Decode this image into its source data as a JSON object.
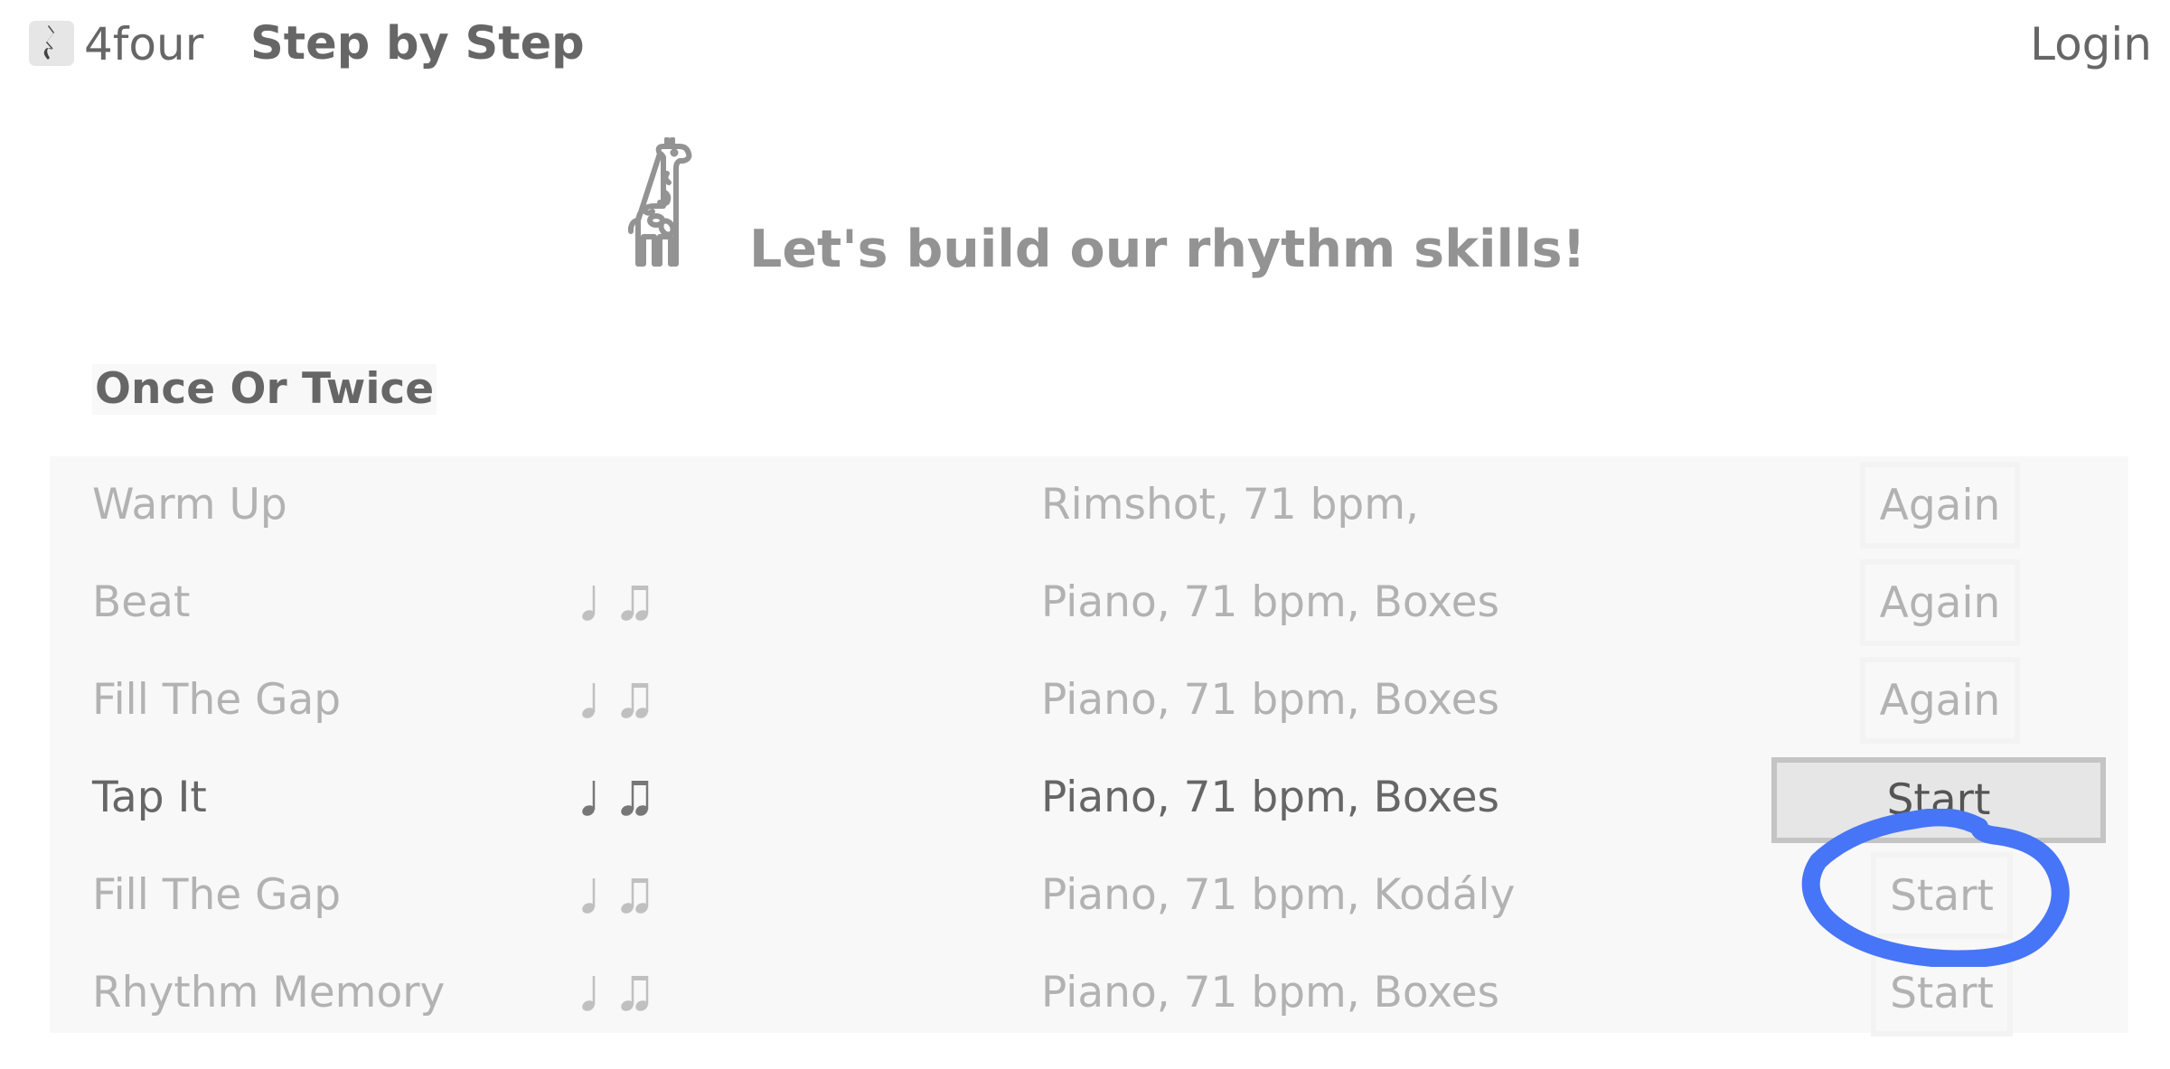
{
  "header": {
    "logo_icon": "quarter-rest-icon",
    "brand": "4four",
    "title": "Step by Step",
    "login_label": "Login"
  },
  "hero": {
    "icon": "giraffe-icon",
    "headline": "Let's build our rhythm skills!"
  },
  "section": {
    "title": "Once Or Twice"
  },
  "exercises": [
    {
      "name": "Warm Up",
      "notes": [],
      "info": "Rimshot, 71 bpm,",
      "action": "Again",
      "state": "done"
    },
    {
      "name": "Beat",
      "notes": [
        "quarter-note-icon",
        "beamed-eighth-notes-icon"
      ],
      "info": "Piano, 71 bpm, Boxes",
      "action": "Again",
      "state": "done"
    },
    {
      "name": "Fill The Gap",
      "notes": [
        "quarter-note-icon",
        "beamed-eighth-notes-icon"
      ],
      "info": "Piano, 71 bpm, Boxes",
      "action": "Again",
      "state": "done"
    },
    {
      "name": "Tap It",
      "notes": [
        "quarter-note-icon",
        "beamed-eighth-notes-icon"
      ],
      "info": "Piano, 71 bpm, Boxes",
      "action": "Start",
      "state": "current"
    },
    {
      "name": "Fill The Gap",
      "notes": [
        "quarter-note-icon",
        "beamed-eighth-notes-icon"
      ],
      "info": "Piano, 71 bpm, Kodály",
      "action": "Start",
      "state": "locked"
    },
    {
      "name": "Rhythm Memory",
      "notes": [
        "quarter-note-icon",
        "beamed-eighth-notes-icon"
      ],
      "info": "Piano, 71 bpm, Boxes",
      "action": "Start",
      "state": "locked"
    }
  ],
  "annotation": {
    "type": "hand-drawn-circle",
    "target": "exercises.4.action",
    "color": "#4775f7"
  },
  "colors": {
    "text_dark": "#666666",
    "text_faded": "#b2b2b2",
    "headline": "#939393",
    "table_bg": "#f8f8f8",
    "active_button_bg": "#e6e6e6",
    "active_button_border": "#c4c4c4"
  }
}
